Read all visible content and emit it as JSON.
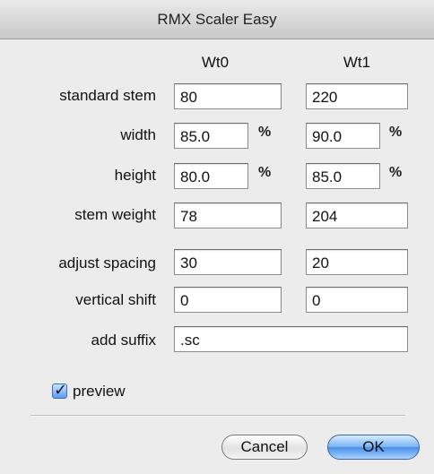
{
  "window": {
    "title": "RMX Scaler Easy"
  },
  "columns": {
    "wt0": "Wt0",
    "wt1": "Wt1"
  },
  "rows": [
    {
      "label": "standard stem",
      "wt0": "80",
      "wt1": "220"
    },
    {
      "label": "width",
      "wt0": "85.0",
      "wt1": "90.0",
      "unit": "%"
    },
    {
      "label": "height",
      "wt0": "80.0",
      "wt1": "85.0",
      "unit": "%"
    },
    {
      "label": "stem weight",
      "wt0": "78",
      "wt1": "204"
    },
    {
      "label": "adjust spacing",
      "wt0": "30",
      "wt1": "20"
    },
    {
      "label": "vertical shift",
      "wt0": "0",
      "wt1": "0"
    }
  ],
  "suffix": {
    "label": "add suffix",
    "value": ".sc"
  },
  "preview": {
    "label": "preview",
    "checked": true
  },
  "buttons": {
    "cancel": "Cancel",
    "ok": "OK"
  }
}
